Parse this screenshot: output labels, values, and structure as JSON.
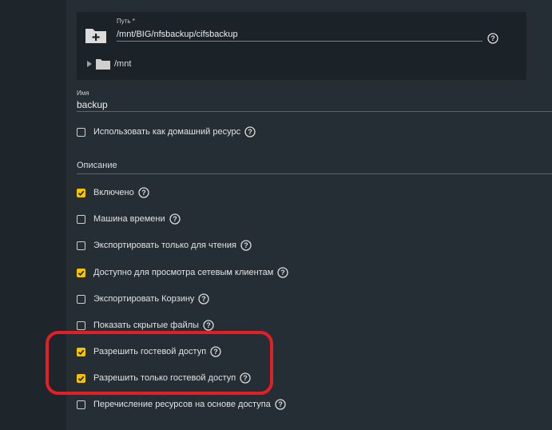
{
  "path_field": {
    "label": "Путь *",
    "value": "/mnt/BIG/nfsbackup/cifsbackup"
  },
  "tree": {
    "root_label": "/mnt"
  },
  "name_field": {
    "label": "Имя",
    "value": "backup"
  },
  "home_share_label": "Использовать как домашний ресурс",
  "description_label": "Описание",
  "options": [
    {
      "label": "Включено",
      "checked": true
    },
    {
      "label": "Машина времени",
      "checked": false
    },
    {
      "label": "Экспортировать только для чтения",
      "checked": false
    },
    {
      "label": "Доступно для просмотра сетевым клиентам",
      "checked": true
    },
    {
      "label": "Экспортировать Корзину",
      "checked": false
    },
    {
      "label": "Показать скрытые файлы",
      "checked": false
    },
    {
      "label": "Разрешить гостевой доступ",
      "checked": true
    },
    {
      "label": "Разрешить только гостевой доступ",
      "checked": true
    },
    {
      "label": "Перечисление ресурсов на основе доступа",
      "checked": false
    }
  ],
  "colors": {
    "accent": "#f4c400",
    "highlight": "#e21f26",
    "panel": "#262e35"
  }
}
